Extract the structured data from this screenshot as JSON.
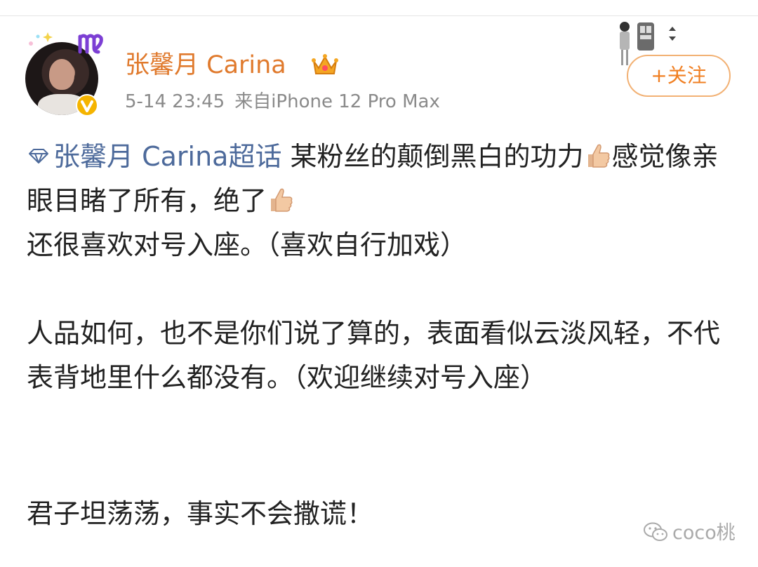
{
  "user": {
    "name": "张馨月 Carina",
    "time": "5-14 23:45",
    "source": "来自iPhone 12 Pro Max"
  },
  "actions": {
    "follow_label": "+关注"
  },
  "post": {
    "topic_label": "张馨月 Carina超话",
    "p1_a": " 某粉丝的颠倒黑白的功力",
    "p1_b": "感觉像亲眼目睹了所有，绝了",
    "p1_c": "还很喜欢对号入座。（喜欢自行加戏）",
    "p2": "人品如何，也不是你们说了算的，表面看似云淡风轻，不代表背地里什么都没有。（欢迎继续对号入座）",
    "p3": "君子坦荡荡，事实不会撒谎！"
  },
  "watermark": {
    "text": "coco桃"
  },
  "colors": {
    "username": "#e07a2d",
    "topic_link": "#4d6a9b",
    "follow": "#f07f22",
    "meta": "#8a8a8a"
  },
  "icons": [
    "sparkle-icon",
    "zodiac-virgo-icon",
    "verified-icon",
    "crown-icon",
    "diamond-icon",
    "thumbs-up-icon",
    "wechat-icon"
  ]
}
